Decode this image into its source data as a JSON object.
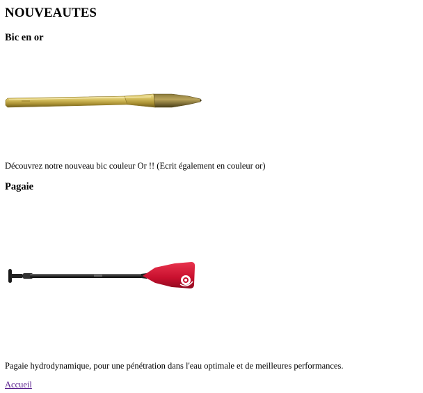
{
  "page": {
    "title": "NOUVEAUTES"
  },
  "products": [
    {
      "name": "Bic en or",
      "image": "gold-pen-image",
      "description": "Découvrez notre nouveau bic couleur Or !! (Ecrit également en couleur or)"
    },
    {
      "name": "Pagaie",
      "image": "paddle-image",
      "description": "Pagaie hydrodynamique, pour une pénétration dans l'eau optimale et de meilleures performances."
    }
  ],
  "nav": {
    "home_label": "Accueil"
  },
  "colors": {
    "link_visited": "#551a8b",
    "pen_gold": "#c9b24a",
    "paddle_blade": "#c8102e",
    "paddle_shaft": "#2a2a2a"
  }
}
